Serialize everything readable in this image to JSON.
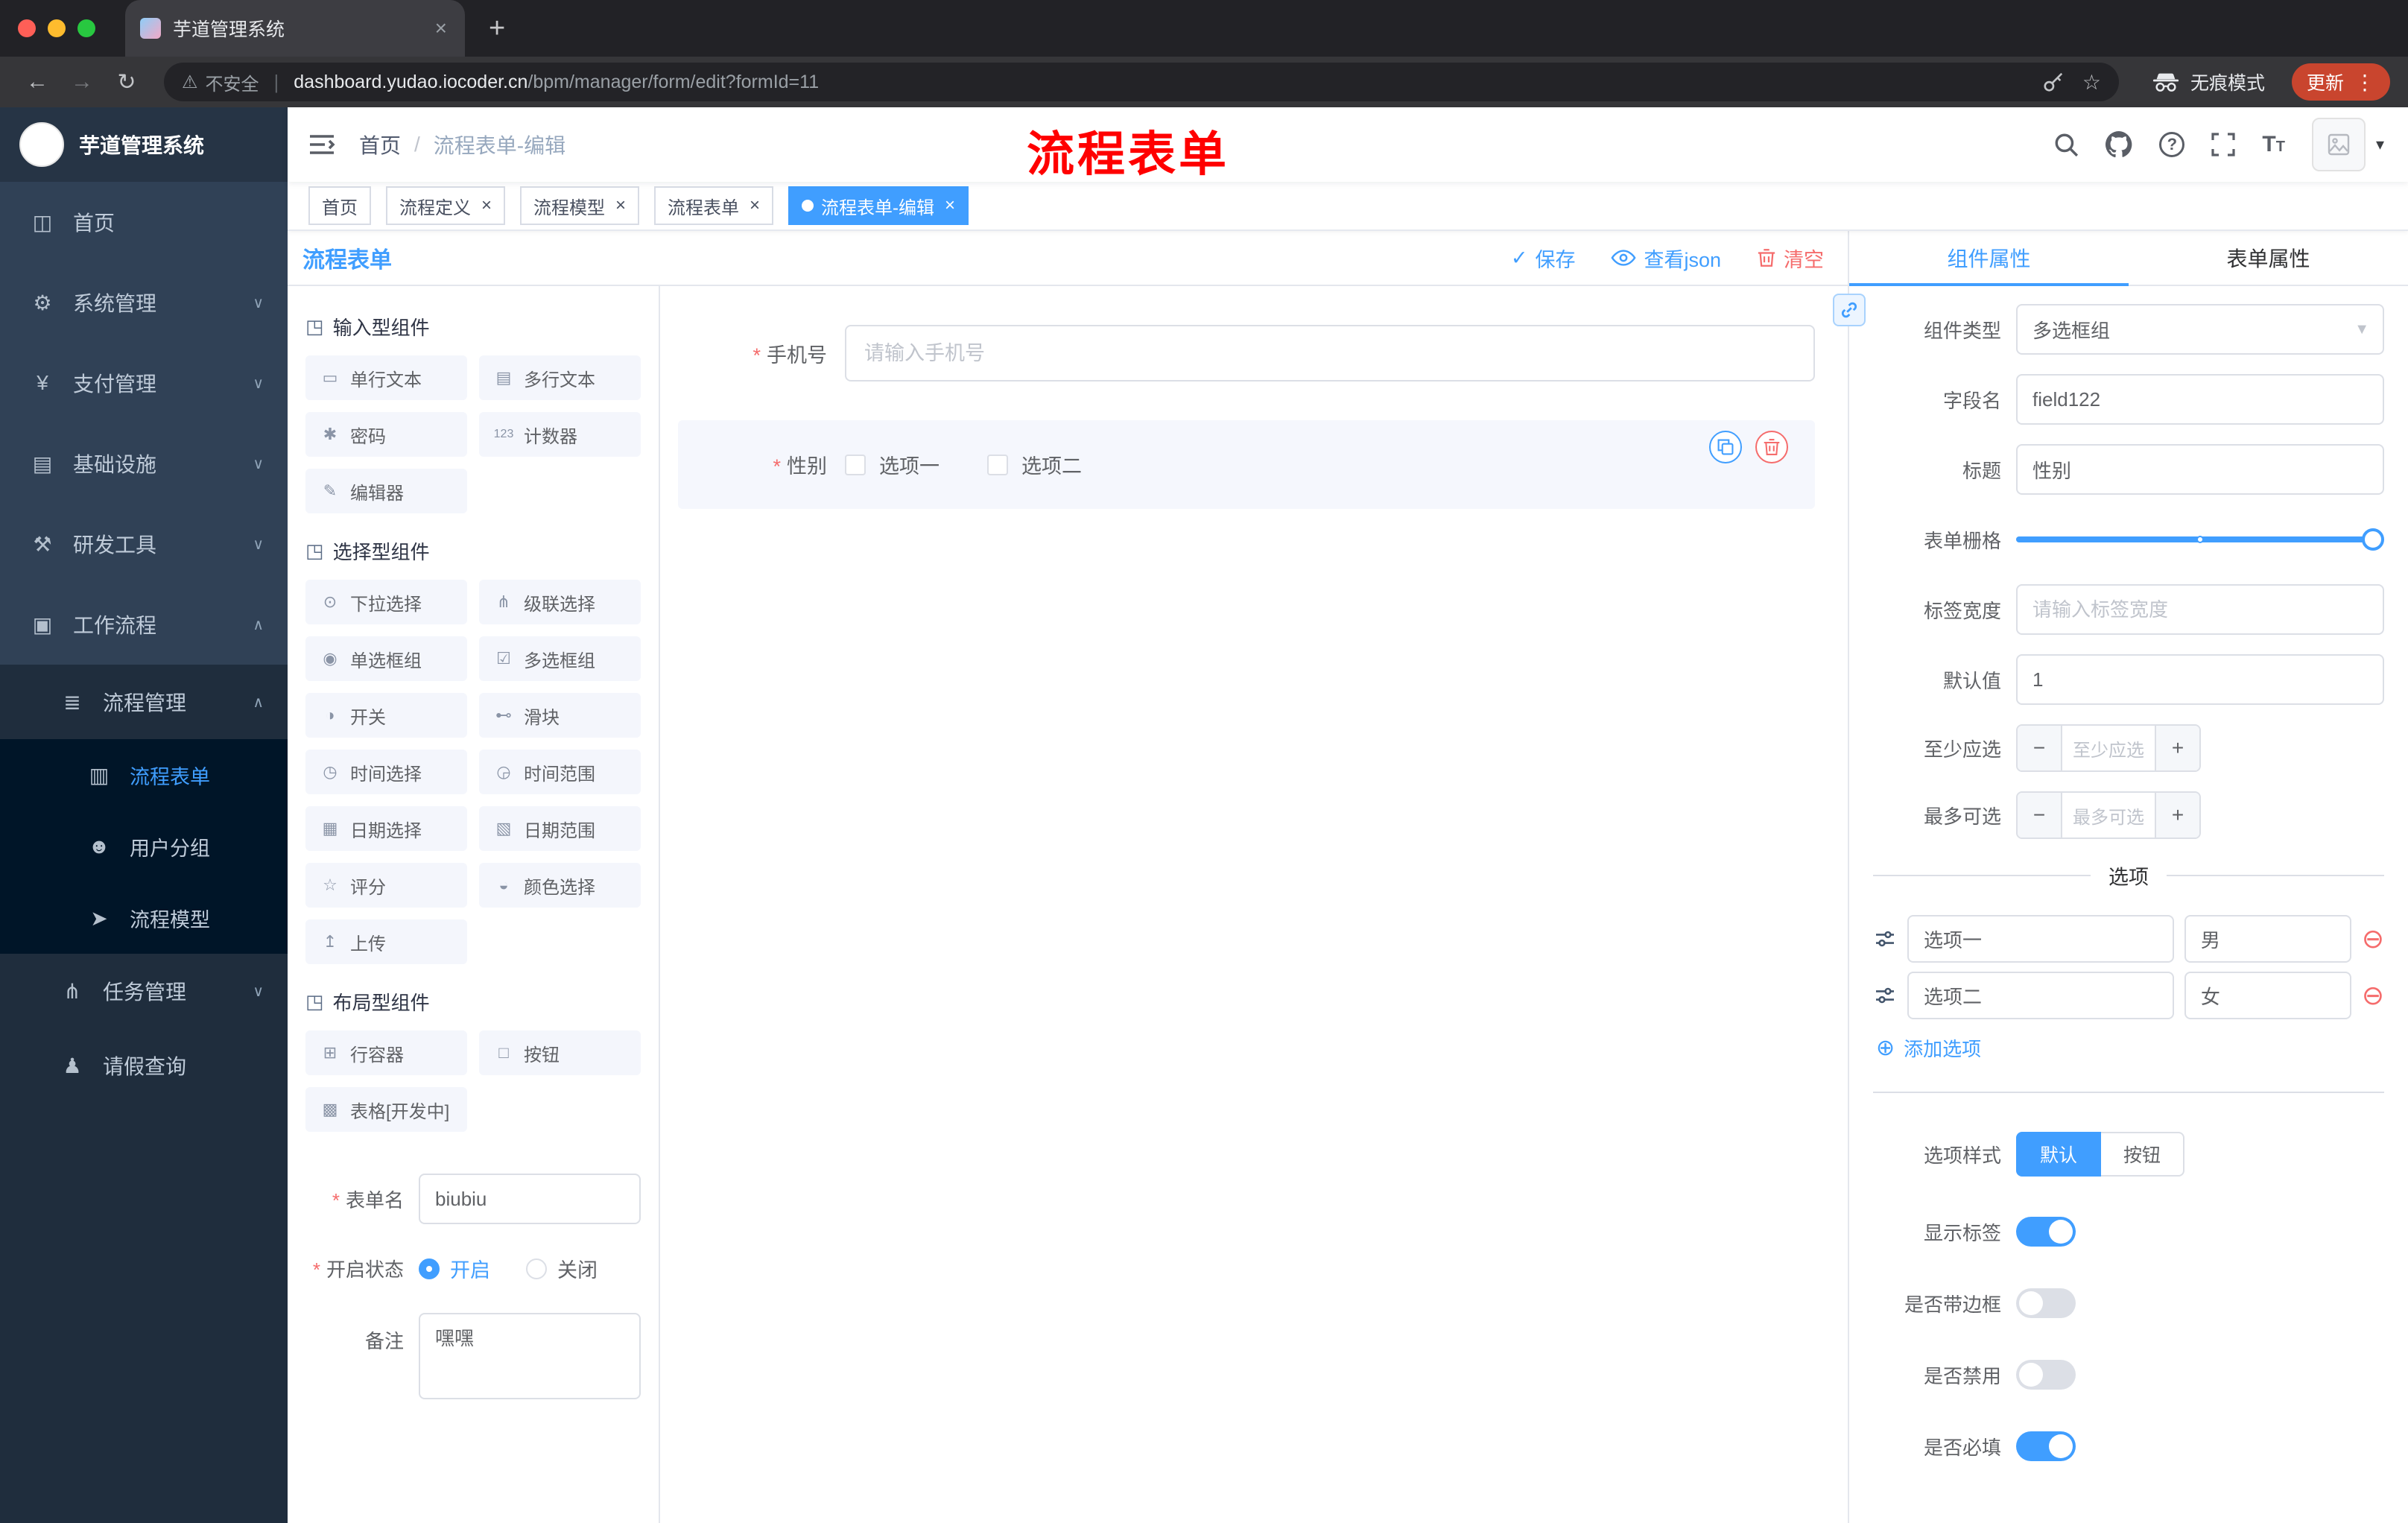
{
  "theme": {
    "primary": "#409eff",
    "danger": "#f56c6c",
    "annotation": "#ff0000"
  },
  "browser": {
    "tab_title": "芋道管理系统",
    "security": "不安全",
    "domain": "dashboard.yudao.iocoder.cn",
    "path": "/bpm/manager/form/edit?formId=11",
    "incognito": "无痕模式",
    "update": "更新"
  },
  "sidebar": {
    "logo_title": "芋道管理系统",
    "items": [
      {
        "label": "首页"
      },
      {
        "label": "系统管理"
      },
      {
        "label": "支付管理"
      },
      {
        "label": "基础设施"
      },
      {
        "label": "研发工具"
      },
      {
        "label": "工作流程"
      },
      {
        "label": "流程管理"
      },
      {
        "label": "流程表单"
      },
      {
        "label": "用户分组"
      },
      {
        "label": "流程模型"
      },
      {
        "label": "任务管理"
      },
      {
        "label": "请假查询"
      }
    ]
  },
  "header": {
    "breadcrumb_root": "首页",
    "breadcrumb_current": "流程表单-编辑",
    "annotation": "流程表单"
  },
  "tags": [
    {
      "label": "首页"
    },
    {
      "label": "流程定义"
    },
    {
      "label": "流程模型"
    },
    {
      "label": "流程表单"
    },
    {
      "label": "流程表单-编辑"
    }
  ],
  "designer": {
    "title": "流程表单",
    "save": "保存",
    "view_json": "查看json",
    "clear": "清空",
    "groups": [
      {
        "title": "输入型组件",
        "items": [
          "单行文本",
          "多行文本",
          "密码",
          "计数器",
          "编辑器"
        ]
      },
      {
        "title": "选择型组件",
        "items": [
          "下拉选择",
          "级联选择",
          "单选框组",
          "多选框组",
          "开关",
          "滑块",
          "时间选择",
          "时间范围",
          "日期选择",
          "日期范围",
          "评分",
          "颜色选择",
          "上传"
        ]
      },
      {
        "title": "布局型组件",
        "items": [
          "行容器",
          "按钮",
          "表格[开发中]"
        ]
      }
    ],
    "meta": {
      "name_label": "表单名",
      "name_value": "biubiu",
      "status_label": "开启状态",
      "status_on": "开启",
      "status_off": "关闭",
      "remark_label": "备注",
      "remark_value": "嘿嘿"
    }
  },
  "canvas": {
    "phone_label": "手机号",
    "phone_placeholder": "请输入手机号",
    "gender_label": "性别",
    "gender_opt1": "选项一",
    "gender_opt2": "选项二"
  },
  "inspector": {
    "tab_component": "组件属性",
    "tab_form": "表单属性",
    "rows": {
      "type": {
        "label": "组件类型",
        "value": "多选框组"
      },
      "field": {
        "label": "字段名",
        "value": "field122"
      },
      "title": {
        "label": "标题",
        "value": "性别"
      },
      "grid": {
        "label": "表单栅格"
      },
      "label_width": {
        "label": "标签宽度",
        "placeholder": "请输入标签宽度"
      },
      "default": {
        "label": "默认值",
        "value": "1"
      },
      "min": {
        "label": "至少应选",
        "placeholder": "至少应选"
      },
      "max": {
        "label": "最多可选",
        "placeholder": "最多可选"
      }
    },
    "options": {
      "title": "选项",
      "rows": [
        {
          "label": "选项一",
          "value": "男"
        },
        {
          "label": "选项二",
          "value": "女"
        }
      ],
      "add": "添加选项"
    },
    "style_row": {
      "label": "选项样式",
      "option_default": "默认",
      "option_button": "按钮"
    },
    "toggles": [
      {
        "label": "显示标签",
        "on": true
      },
      {
        "label": "是否带边框",
        "on": false
      },
      {
        "label": "是否禁用",
        "on": false
      },
      {
        "label": "是否必填",
        "on": true
      }
    ]
  }
}
